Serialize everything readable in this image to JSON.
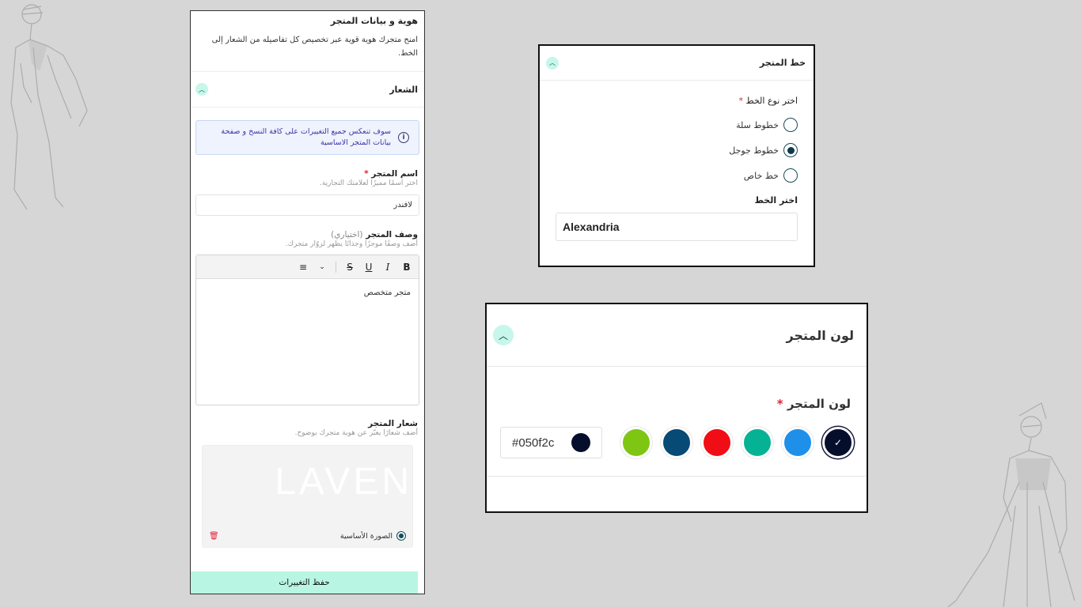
{
  "store_identity": {
    "title": "هوية و بيانات المتجر",
    "description": "امنح متجرك هوية قوية عبر تخصيص كل تفاصيله من الشعار إلى الخط.",
    "logo_section_title": "الشعار",
    "info_notice": "سوف تنعكس جميع التغييرات على كافة النسخ و صفحة بيانات المتجر الاساسية",
    "store_name_label": "اسم المتجر",
    "store_name_required": "*",
    "store_name_hint": "اختر اسمًا مميزًا لعلامتك التجارية.",
    "store_name_value": "لافندر",
    "store_desc_label": "وصف المتجر",
    "store_desc_optional": "(اختياري)",
    "store_desc_hint": "أضف وصفًا موجزًا وجذابًا يظهر لزوّار متجرك.",
    "editor_toolbar": {
      "bold": "B",
      "italic": "I",
      "underline": "U",
      "strike": "S",
      "align": "≡",
      "dropdown": "⌄"
    },
    "store_desc_value": "متجر متخصص",
    "store_logo_label": "شعار المتجر",
    "store_logo_hint": "أضف شعارًا يعبّر عن هوية متجرك بوضوح.",
    "logo_image_text": "LAVEN",
    "logo_main_label": "الصورة الأساسية",
    "save_button": "حفظ التغييرات"
  },
  "store_font": {
    "title": "خط المتجر",
    "font_type_label": "اختر نوع الخط",
    "required": "*",
    "options": [
      {
        "label": "خطوط سلة",
        "checked": false
      },
      {
        "label": "خطوط جوجل",
        "checked": true
      },
      {
        "label": "خط خاص",
        "checked": false
      }
    ],
    "font_select_label": "اختر الخط",
    "font_value": "Alexandria"
  },
  "store_color": {
    "title": "لون المتجر",
    "label": "لون المتجر",
    "required": "*",
    "swatches": [
      {
        "color": "#050f2c",
        "selected": true
      },
      {
        "color": "#1e90ea",
        "selected": false
      },
      {
        "color": "#05b394",
        "selected": false
      },
      {
        "color": "#f10d15",
        "selected": false
      },
      {
        "color": "#064a75",
        "selected": false
      },
      {
        "color": "#7ec613",
        "selected": false
      }
    ],
    "hex_value": "#050f2c"
  }
}
